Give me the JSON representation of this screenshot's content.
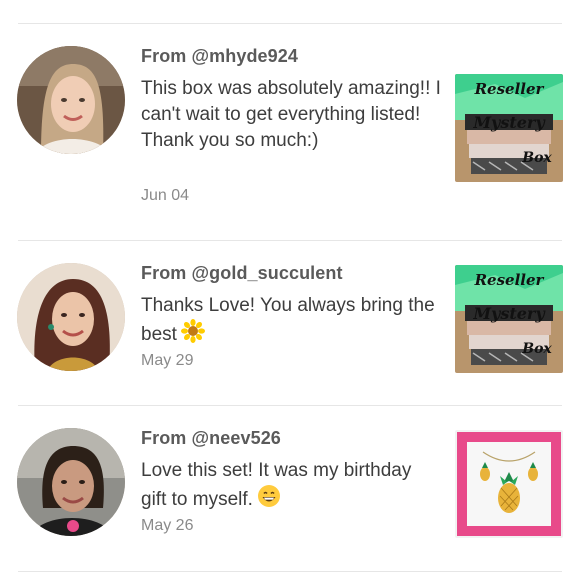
{
  "reviews": [
    {
      "from": "From @mhyde924",
      "text": "This box was absolutely amazing!! I can't wait to get everything listed! Thank you so much:)",
      "date": "Jun 04",
      "product_caption": [
        "Reseller",
        "Mystery",
        "Box"
      ]
    },
    {
      "from": "From @gold_succulent",
      "text": "Thanks Love! You always bring the best",
      "emoji": "sunflower-icon",
      "date": "May 29",
      "product_caption": [
        "Reseller",
        "Mystery",
        "Box"
      ]
    },
    {
      "from": "From @neev526",
      "text": "Love this set! It was my birthday gift to myself.",
      "emoji": "grinning-face-icon",
      "date": "May 26",
      "product_caption": []
    }
  ],
  "colors": {
    "accent_green": "#2ec27e",
    "accent_pink": "#e84a8a"
  }
}
